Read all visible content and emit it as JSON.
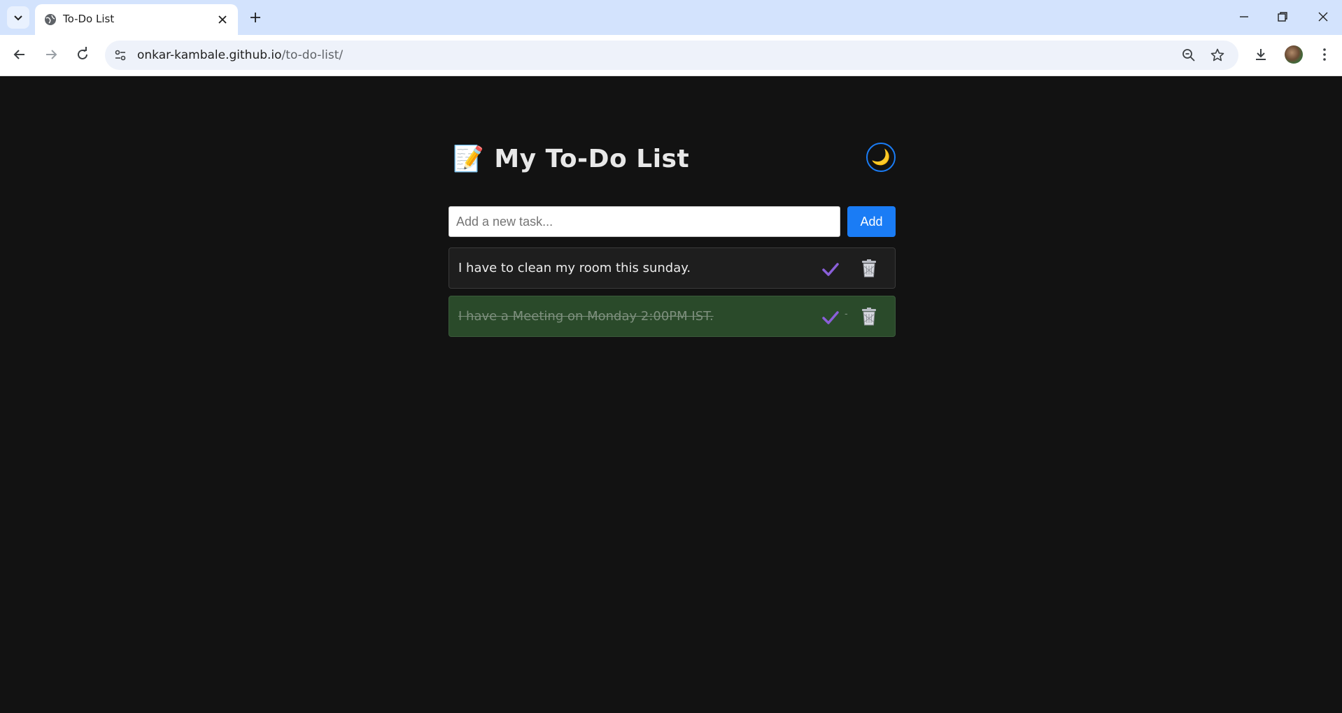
{
  "browser": {
    "tab_title": "To-Do List",
    "url_host": "onkar-kambale.github.io",
    "url_path": "/to-do-list/"
  },
  "app": {
    "title": "My To-Do List",
    "title_icon": "memo-emoji",
    "title_emoji": "📝",
    "theme_toggle_icon": "moon-icon",
    "theme_toggle_emoji": "🌙",
    "input_placeholder": "Add a new task...",
    "input_value": "",
    "add_label": "Add",
    "tasks": [
      {
        "text": "I have to clean my room this sunday.",
        "completed": false
      },
      {
        "text": "I have a Meeting on Monday 2:00PM IST.",
        "completed": true
      }
    ]
  },
  "colors": {
    "page_bg": "#121212",
    "accent": "#1a7cf5",
    "completed_bg": "#2a4a2a",
    "check": "#8a5fd8"
  }
}
